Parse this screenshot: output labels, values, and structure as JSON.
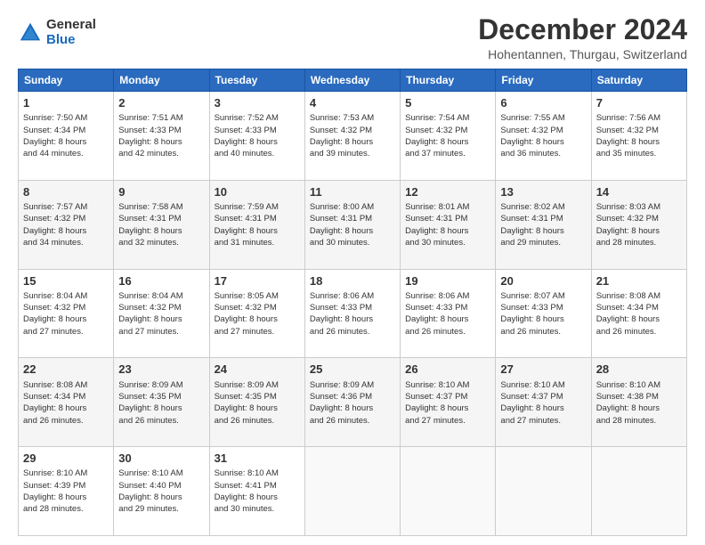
{
  "logo": {
    "general": "General",
    "blue": "Blue"
  },
  "header": {
    "title": "December 2024",
    "subtitle": "Hohentannen, Thurgau, Switzerland"
  },
  "days_of_week": [
    "Sunday",
    "Monday",
    "Tuesday",
    "Wednesday",
    "Thursday",
    "Friday",
    "Saturday"
  ],
  "weeks": [
    [
      {
        "day": "1",
        "lines": [
          "Sunrise: 7:50 AM",
          "Sunset: 4:34 PM",
          "Daylight: 8 hours",
          "and 44 minutes."
        ]
      },
      {
        "day": "2",
        "lines": [
          "Sunrise: 7:51 AM",
          "Sunset: 4:33 PM",
          "Daylight: 8 hours",
          "and 42 minutes."
        ]
      },
      {
        "day": "3",
        "lines": [
          "Sunrise: 7:52 AM",
          "Sunset: 4:33 PM",
          "Daylight: 8 hours",
          "and 40 minutes."
        ]
      },
      {
        "day": "4",
        "lines": [
          "Sunrise: 7:53 AM",
          "Sunset: 4:32 PM",
          "Daylight: 8 hours",
          "and 39 minutes."
        ]
      },
      {
        "day": "5",
        "lines": [
          "Sunrise: 7:54 AM",
          "Sunset: 4:32 PM",
          "Daylight: 8 hours",
          "and 37 minutes."
        ]
      },
      {
        "day": "6",
        "lines": [
          "Sunrise: 7:55 AM",
          "Sunset: 4:32 PM",
          "Daylight: 8 hours",
          "and 36 minutes."
        ]
      },
      {
        "day": "7",
        "lines": [
          "Sunrise: 7:56 AM",
          "Sunset: 4:32 PM",
          "Daylight: 8 hours",
          "and 35 minutes."
        ]
      }
    ],
    [
      {
        "day": "8",
        "lines": [
          "Sunrise: 7:57 AM",
          "Sunset: 4:32 PM",
          "Daylight: 8 hours",
          "and 34 minutes."
        ]
      },
      {
        "day": "9",
        "lines": [
          "Sunrise: 7:58 AM",
          "Sunset: 4:31 PM",
          "Daylight: 8 hours",
          "and 32 minutes."
        ]
      },
      {
        "day": "10",
        "lines": [
          "Sunrise: 7:59 AM",
          "Sunset: 4:31 PM",
          "Daylight: 8 hours",
          "and 31 minutes."
        ]
      },
      {
        "day": "11",
        "lines": [
          "Sunrise: 8:00 AM",
          "Sunset: 4:31 PM",
          "Daylight: 8 hours",
          "and 30 minutes."
        ]
      },
      {
        "day": "12",
        "lines": [
          "Sunrise: 8:01 AM",
          "Sunset: 4:31 PM",
          "Daylight: 8 hours",
          "and 30 minutes."
        ]
      },
      {
        "day": "13",
        "lines": [
          "Sunrise: 8:02 AM",
          "Sunset: 4:31 PM",
          "Daylight: 8 hours",
          "and 29 minutes."
        ]
      },
      {
        "day": "14",
        "lines": [
          "Sunrise: 8:03 AM",
          "Sunset: 4:32 PM",
          "Daylight: 8 hours",
          "and 28 minutes."
        ]
      }
    ],
    [
      {
        "day": "15",
        "lines": [
          "Sunrise: 8:04 AM",
          "Sunset: 4:32 PM",
          "Daylight: 8 hours",
          "and 27 minutes."
        ]
      },
      {
        "day": "16",
        "lines": [
          "Sunrise: 8:04 AM",
          "Sunset: 4:32 PM",
          "Daylight: 8 hours",
          "and 27 minutes."
        ]
      },
      {
        "day": "17",
        "lines": [
          "Sunrise: 8:05 AM",
          "Sunset: 4:32 PM",
          "Daylight: 8 hours",
          "and 27 minutes."
        ]
      },
      {
        "day": "18",
        "lines": [
          "Sunrise: 8:06 AM",
          "Sunset: 4:33 PM",
          "Daylight: 8 hours",
          "and 26 minutes."
        ]
      },
      {
        "day": "19",
        "lines": [
          "Sunrise: 8:06 AM",
          "Sunset: 4:33 PM",
          "Daylight: 8 hours",
          "and 26 minutes."
        ]
      },
      {
        "day": "20",
        "lines": [
          "Sunrise: 8:07 AM",
          "Sunset: 4:33 PM",
          "Daylight: 8 hours",
          "and 26 minutes."
        ]
      },
      {
        "day": "21",
        "lines": [
          "Sunrise: 8:08 AM",
          "Sunset: 4:34 PM",
          "Daylight: 8 hours",
          "and 26 minutes."
        ]
      }
    ],
    [
      {
        "day": "22",
        "lines": [
          "Sunrise: 8:08 AM",
          "Sunset: 4:34 PM",
          "Daylight: 8 hours",
          "and 26 minutes."
        ]
      },
      {
        "day": "23",
        "lines": [
          "Sunrise: 8:09 AM",
          "Sunset: 4:35 PM",
          "Daylight: 8 hours",
          "and 26 minutes."
        ]
      },
      {
        "day": "24",
        "lines": [
          "Sunrise: 8:09 AM",
          "Sunset: 4:35 PM",
          "Daylight: 8 hours",
          "and 26 minutes."
        ]
      },
      {
        "day": "25",
        "lines": [
          "Sunrise: 8:09 AM",
          "Sunset: 4:36 PM",
          "Daylight: 8 hours",
          "and 26 minutes."
        ]
      },
      {
        "day": "26",
        "lines": [
          "Sunrise: 8:10 AM",
          "Sunset: 4:37 PM",
          "Daylight: 8 hours",
          "and 27 minutes."
        ]
      },
      {
        "day": "27",
        "lines": [
          "Sunrise: 8:10 AM",
          "Sunset: 4:37 PM",
          "Daylight: 8 hours",
          "and 27 minutes."
        ]
      },
      {
        "day": "28",
        "lines": [
          "Sunrise: 8:10 AM",
          "Sunset: 4:38 PM",
          "Daylight: 8 hours",
          "and 28 minutes."
        ]
      }
    ],
    [
      {
        "day": "29",
        "lines": [
          "Sunrise: 8:10 AM",
          "Sunset: 4:39 PM",
          "Daylight: 8 hours",
          "and 28 minutes."
        ]
      },
      {
        "day": "30",
        "lines": [
          "Sunrise: 8:10 AM",
          "Sunset: 4:40 PM",
          "Daylight: 8 hours",
          "and 29 minutes."
        ]
      },
      {
        "day": "31",
        "lines": [
          "Sunrise: 8:10 AM",
          "Sunset: 4:41 PM",
          "Daylight: 8 hours",
          "and 30 minutes."
        ]
      },
      null,
      null,
      null,
      null
    ]
  ]
}
